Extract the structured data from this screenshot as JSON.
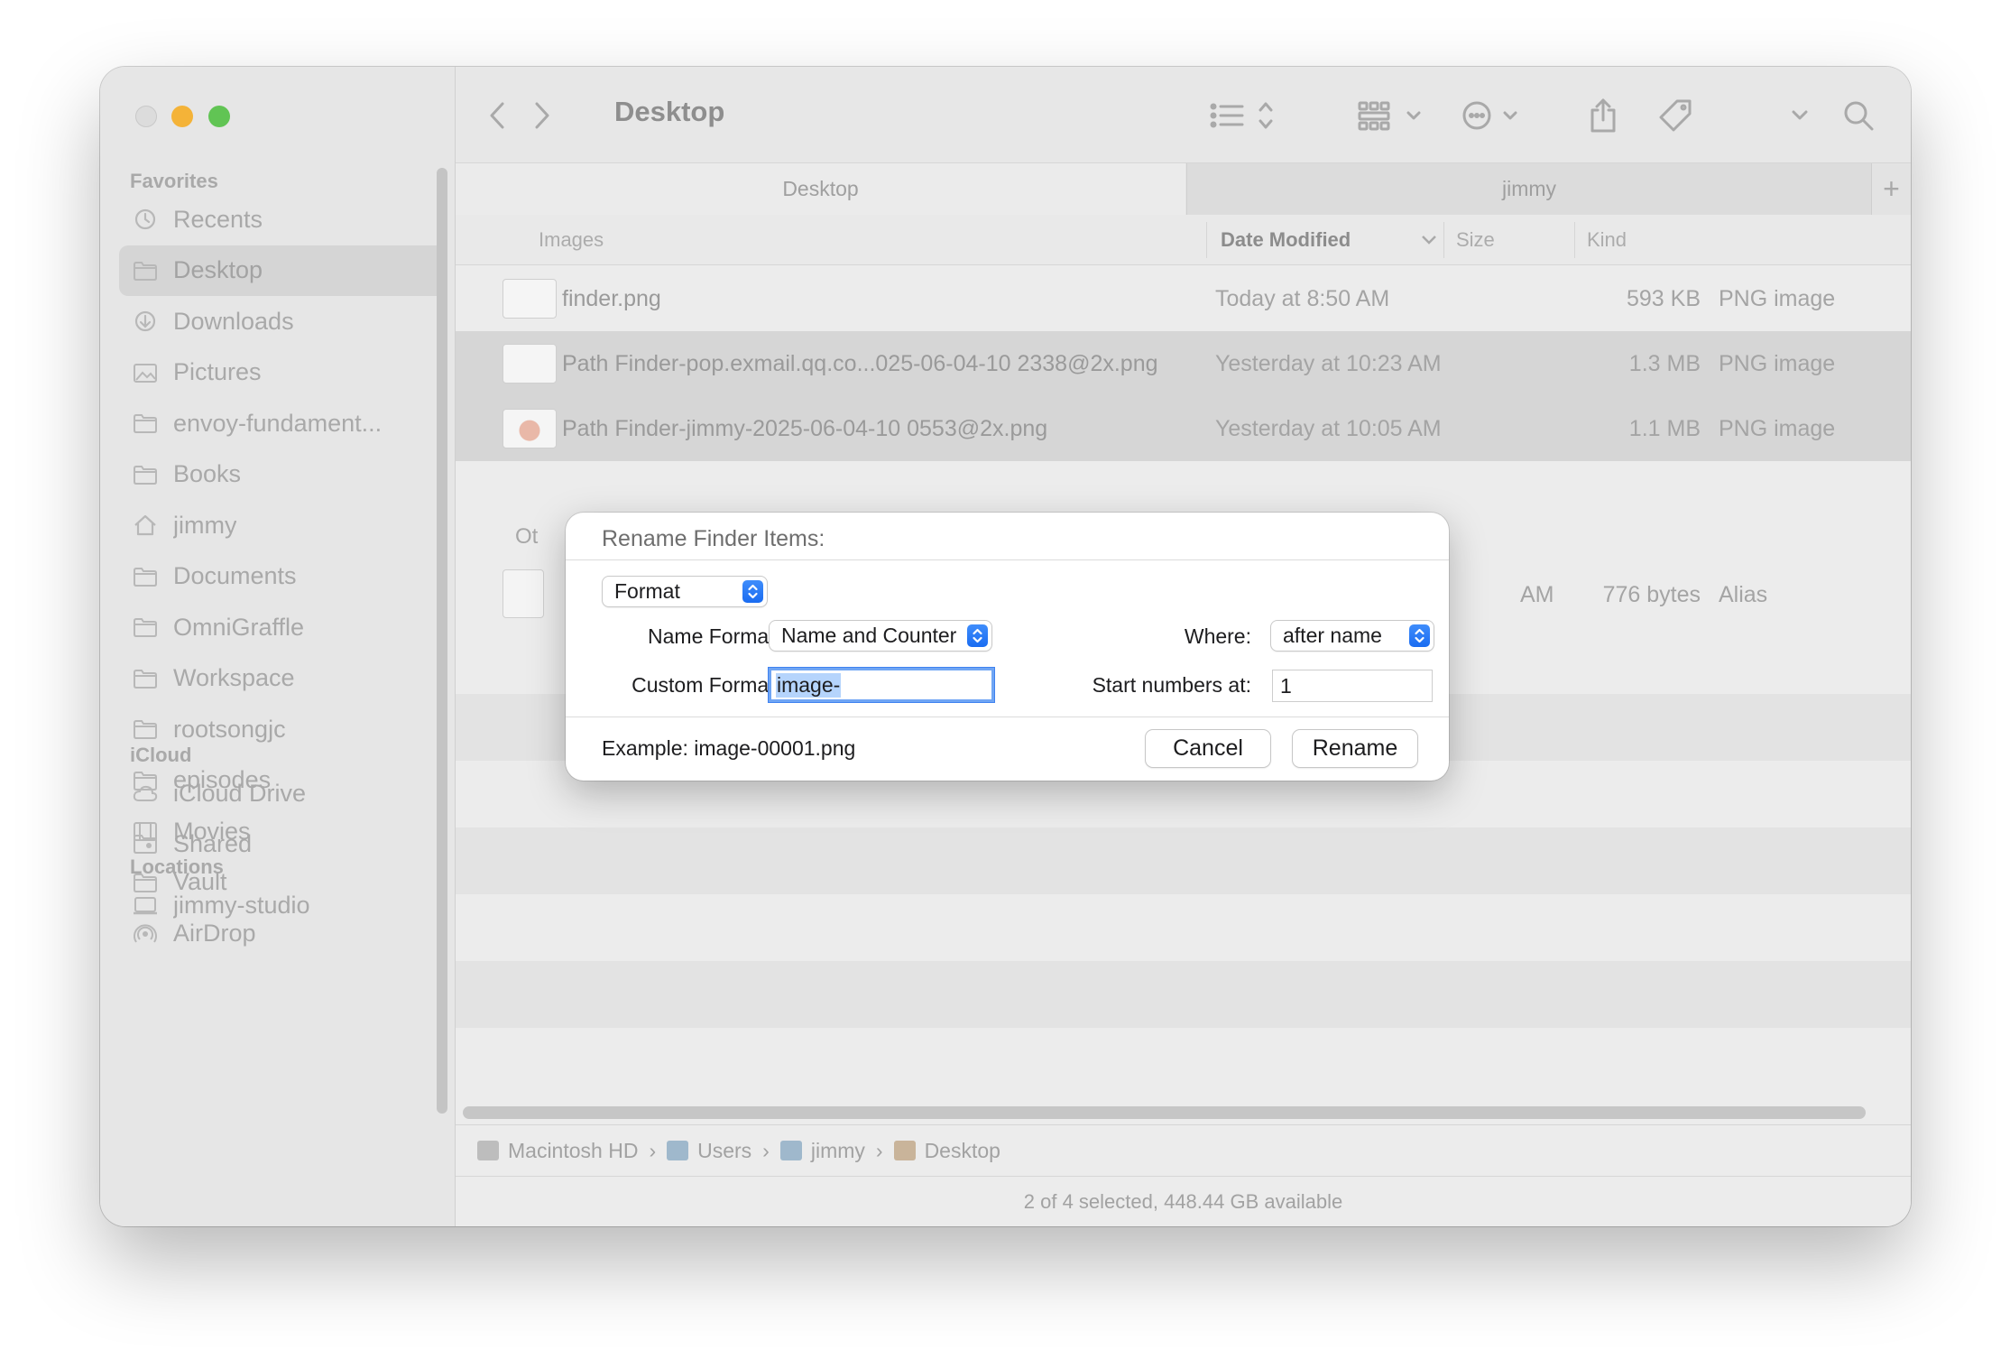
{
  "sidebar": {
    "favorites_label": "Favorites",
    "icloud_label": "iCloud",
    "locations_label": "Locations",
    "favorites": [
      {
        "label": "Recents",
        "icon": "clock-icon"
      },
      {
        "label": "Desktop",
        "icon": "folder-icon",
        "selected": true
      },
      {
        "label": "Downloads",
        "icon": "download-icon"
      },
      {
        "label": "Pictures",
        "icon": "photo-icon"
      },
      {
        "label": "envoy-fundament...",
        "icon": "folder-icon"
      },
      {
        "label": "Books",
        "icon": "folder-icon"
      },
      {
        "label": "jimmy",
        "icon": "home-icon"
      },
      {
        "label": "Documents",
        "icon": "folder-icon"
      },
      {
        "label": "OmniGraffle",
        "icon": "folder-icon"
      },
      {
        "label": "Workspace",
        "icon": "folder-icon"
      },
      {
        "label": "rootsongjc",
        "icon": "folder-icon"
      },
      {
        "label": "episodes",
        "icon": "folder-icon"
      },
      {
        "label": "Movies",
        "icon": "film-icon"
      },
      {
        "label": "Vault",
        "icon": "folder-icon"
      },
      {
        "label": "AirDrop",
        "icon": "airdrop-icon"
      }
    ],
    "icloud": [
      {
        "label": "iCloud Drive",
        "icon": "cloud-icon"
      },
      {
        "label": "Shared",
        "icon": "shared-folder-icon"
      }
    ],
    "locations": [
      {
        "label": "jimmy-studio",
        "icon": "computer-icon"
      }
    ]
  },
  "toolbar": {
    "title": "Desktop"
  },
  "tabs": {
    "desktop": "Desktop",
    "jimmy": "jimmy",
    "add": "+"
  },
  "columns": {
    "name": "Images",
    "date": "Date Modified",
    "size": "Size",
    "kind": "Kind"
  },
  "files": [
    {
      "name": "finder.png",
      "date": "Today at 8:50 AM",
      "size": "593 KB",
      "kind": "PNG image",
      "selected": false
    },
    {
      "name": "Path Finder-pop.exmail.qq.co...025-06-04-10 2338@2x.png",
      "date": "Yesterday at 10:23 AM",
      "size": "1.3 MB",
      "kind": "PNG image",
      "selected": true
    },
    {
      "name": "Path Finder-jimmy-2025-06-04-10 0553@2x.png",
      "date": "Yesterday at 10:05 AM",
      "size": "1.1 MB",
      "kind": "PNG image",
      "selected": true
    }
  ],
  "other_group": {
    "label": "Ot",
    "date_tail": "AM",
    "size": "776 bytes",
    "kind": "Alias"
  },
  "pathbar": [
    "Macintosh HD",
    "Users",
    "jimmy",
    "Desktop"
  ],
  "pathbar_sep": "›",
  "status": "2 of 4 selected, 448.44 GB available",
  "dialog": {
    "title": "Rename Finder Items:",
    "mode": "Format",
    "name_format_label": "Name Format:",
    "name_format_value": "Name and Counter",
    "where_label": "Where:",
    "where_value": "after name",
    "custom_format_label": "Custom Format:",
    "custom_format_value": "image-",
    "start_numbers_label": "Start numbers at:",
    "start_numbers_value": "1",
    "example": "Example: image-00001.png",
    "cancel": "Cancel",
    "rename": "Rename"
  },
  "colors": {
    "stepper_blue": "#1a6cf1",
    "focus_ring": "#6fa5f4",
    "traffic_yellow": "#f4b338",
    "traffic_green": "#61c454"
  }
}
